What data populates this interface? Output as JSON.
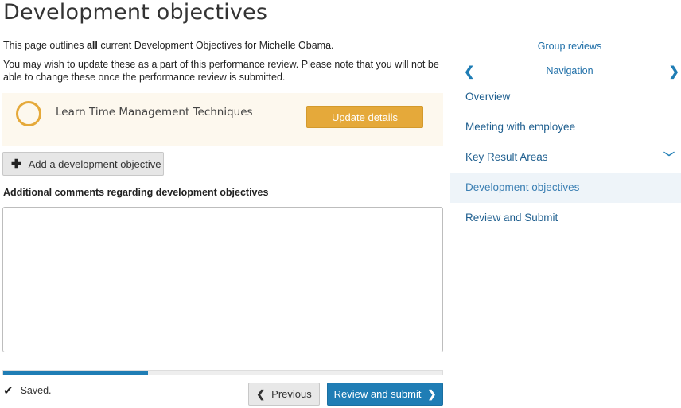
{
  "page": {
    "title": "Development objectives",
    "intro_line1_before": "This page outlines ",
    "intro_line1_bold": "all",
    "intro_line1_after": " current Development Objectives for Michelle Obama.",
    "intro_line2": "You may wish to update these as a part of this performance review. Please note that you will not be able to change these once the performance review is submitted."
  },
  "objectives": [
    {
      "title": "Learn Time Management Techniques",
      "button_label": "Update details"
    }
  ],
  "add_objective_label": "Add a development objective",
  "comments": {
    "label": "Additional comments regarding development objectives",
    "value": ""
  },
  "progress": {
    "percent": 33
  },
  "footer": {
    "saved_text": "Saved.",
    "previous_label": "Previous",
    "submit_label": "Review and submit"
  },
  "sidebar": {
    "group_reviews": "Group reviews",
    "nav_title": "Navigation",
    "items": [
      {
        "label": "Overview"
      },
      {
        "label": "Meeting with employee"
      },
      {
        "label": "Key Result Areas"
      },
      {
        "label": "Development objectives"
      },
      {
        "label": "Review and Submit"
      }
    ]
  },
  "colors": {
    "accent_blue": "#1f7db5",
    "objective_gold": "#e5a93a",
    "active_nav_bg": "#eef4f9"
  }
}
